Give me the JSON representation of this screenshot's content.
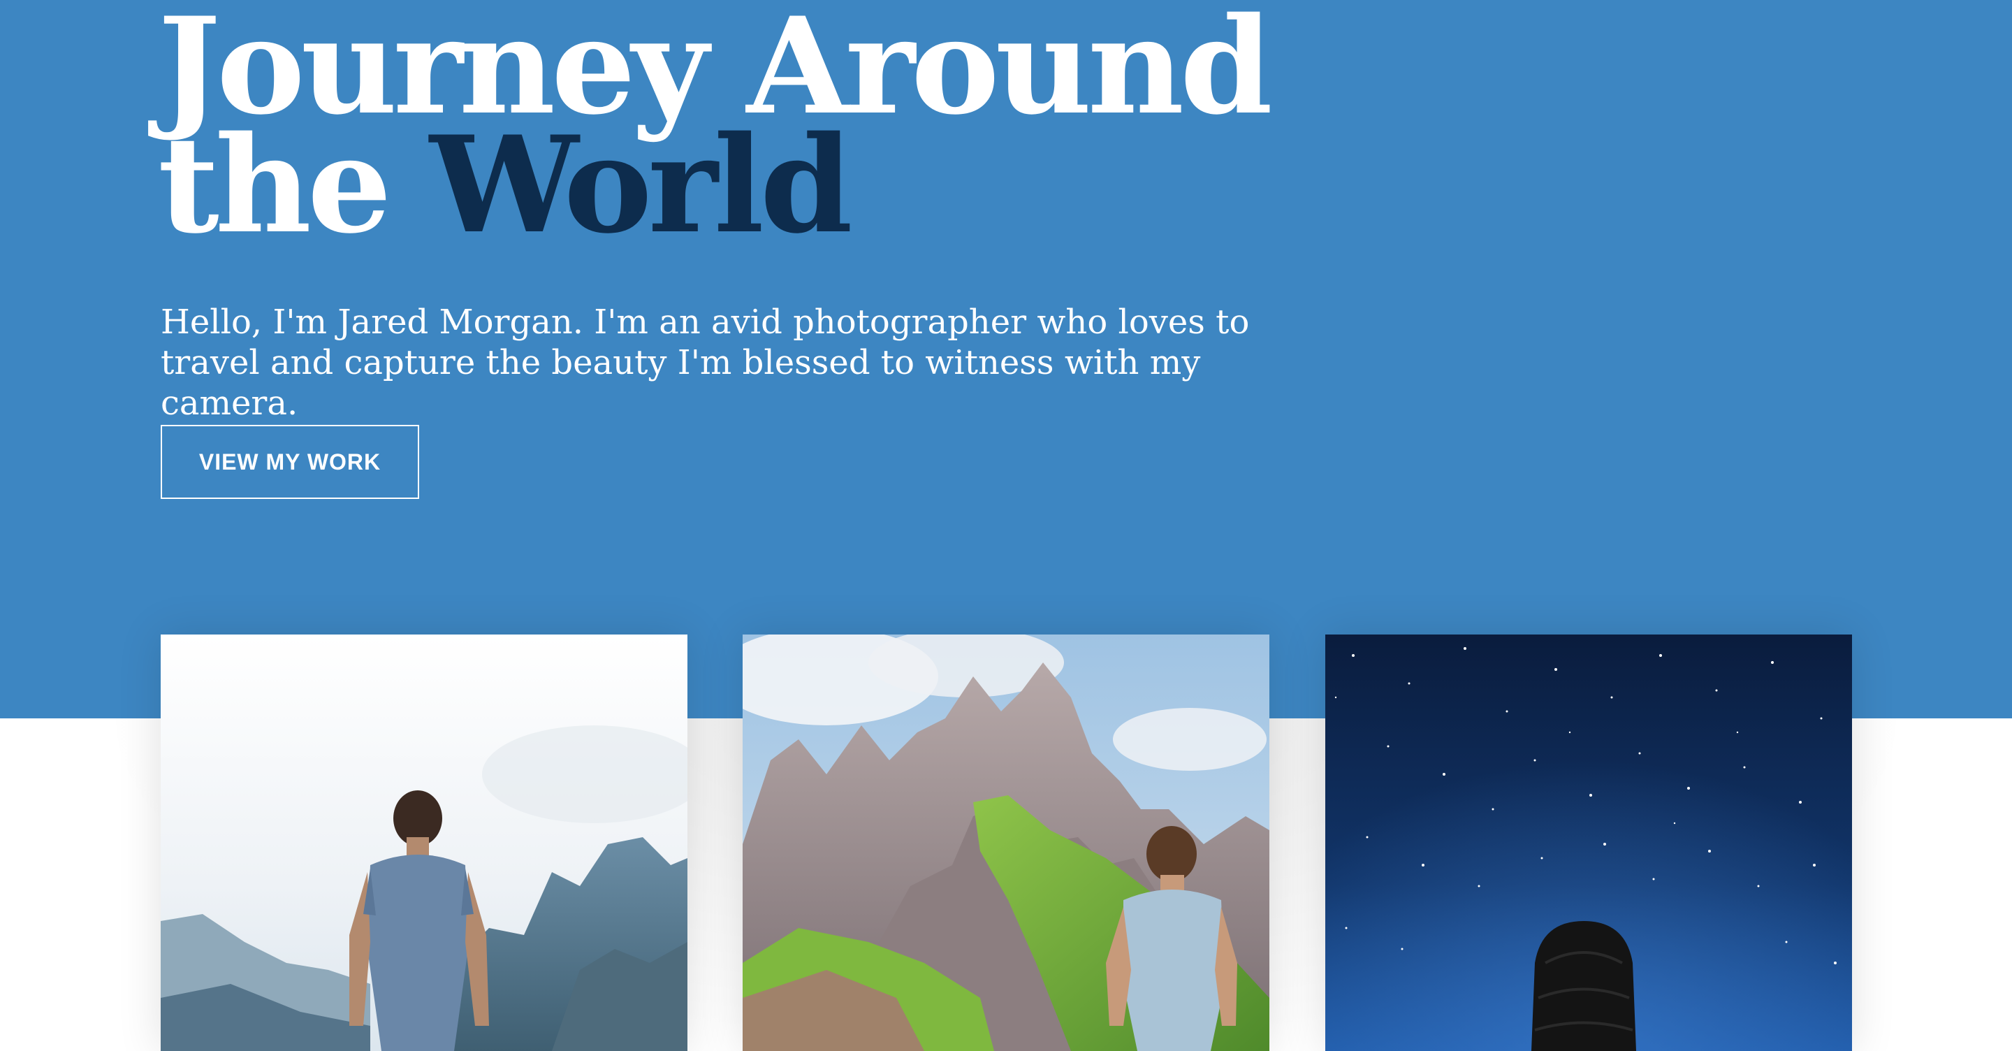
{
  "hero": {
    "title_line1": "Journey Around",
    "title_line2_start": "the",
    "title_line2_accent": "World",
    "intro": "Hello, I'm Jared Morgan. I'm an avid photographer who loves to travel and capture the beauty I'm blessed to witness with my camera.",
    "cta_label": "VIEW MY WORK"
  },
  "colors": {
    "hero_background": "#3d86c2",
    "title_accent": "#0d2c4d",
    "text": "#ffffff"
  },
  "gallery": {
    "photos": [
      {
        "subject": "hiker-overlooking-mountains-photo"
      },
      {
        "subject": "hiker-on-green-ridge-photo"
      },
      {
        "subject": "person-under-starry-sky-photo"
      }
    ]
  }
}
